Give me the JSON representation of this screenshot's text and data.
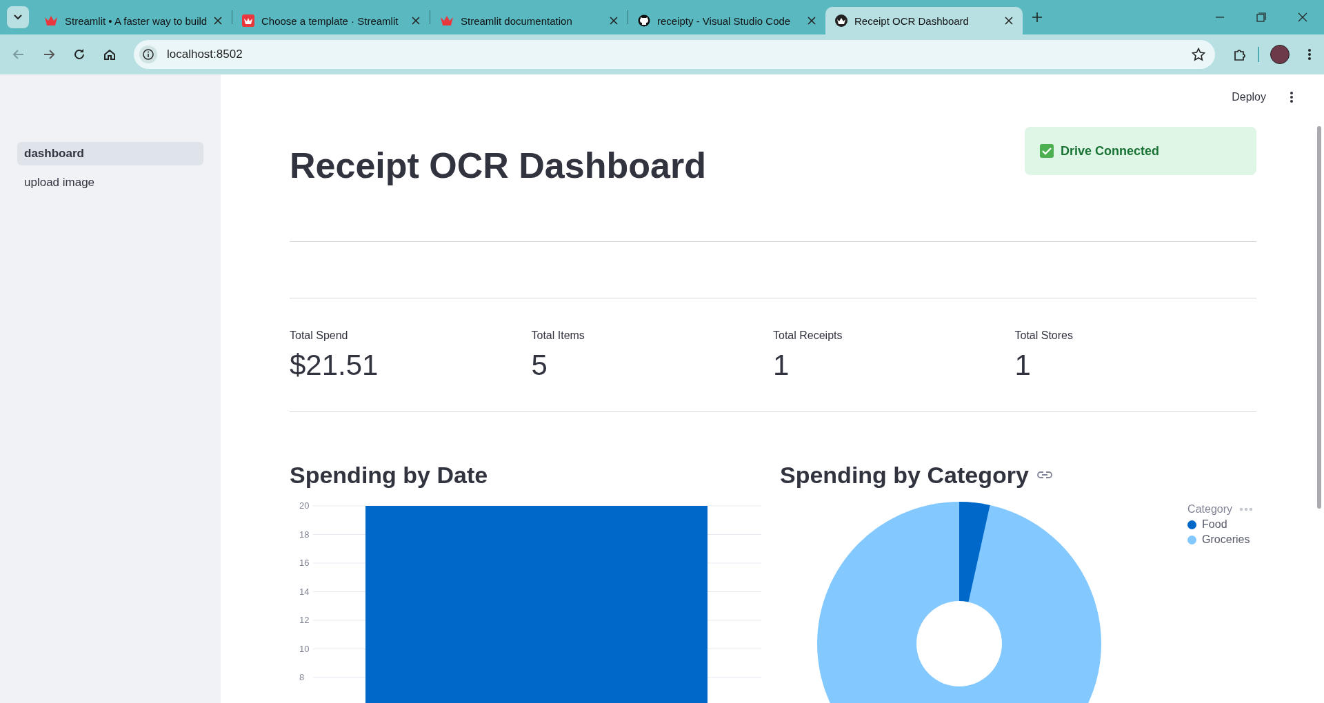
{
  "browser": {
    "tabs": [
      {
        "title": "Streamlit • A faster way to build",
        "selected": false
      },
      {
        "title": "Choose a template · Streamlit",
        "selected": false
      },
      {
        "title": "Streamlit documentation",
        "selected": false
      },
      {
        "title": "receipty - Visual Studio Code",
        "selected": false
      },
      {
        "title": "Receipt OCR Dashboard",
        "selected": true
      }
    ],
    "address": "localhost:8502"
  },
  "sidebar": {
    "items": [
      {
        "label": "dashboard",
        "selected": true
      },
      {
        "label": "upload image",
        "selected": false
      }
    ]
  },
  "toolbar": {
    "deploy": "Deploy"
  },
  "title": "Receipt OCR Dashboard",
  "status": {
    "text": "Drive Connected"
  },
  "metrics": [
    {
      "label": "Total Spend",
      "value": "$21.51"
    },
    {
      "label": "Total Items",
      "value": "5"
    },
    {
      "label": "Total Receipts",
      "value": "1"
    },
    {
      "label": "Total Stores",
      "value": "1"
    }
  ],
  "date_chart": {
    "heading": "Spending by Date",
    "chart_data": {
      "type": "bar",
      "values": [
        20
      ],
      "ylim": [
        0,
        20
      ],
      "grid": true,
      "yticks": [
        8,
        10,
        12,
        14,
        16,
        18,
        20
      ]
    }
  },
  "category_chart": {
    "heading": "Spending by Category",
    "legend_title": "Category",
    "legend": [
      {
        "label": "Food",
        "color": "#0068c9"
      },
      {
        "label": "Groceries",
        "color": "#83c9ff"
      }
    ]
  }
}
